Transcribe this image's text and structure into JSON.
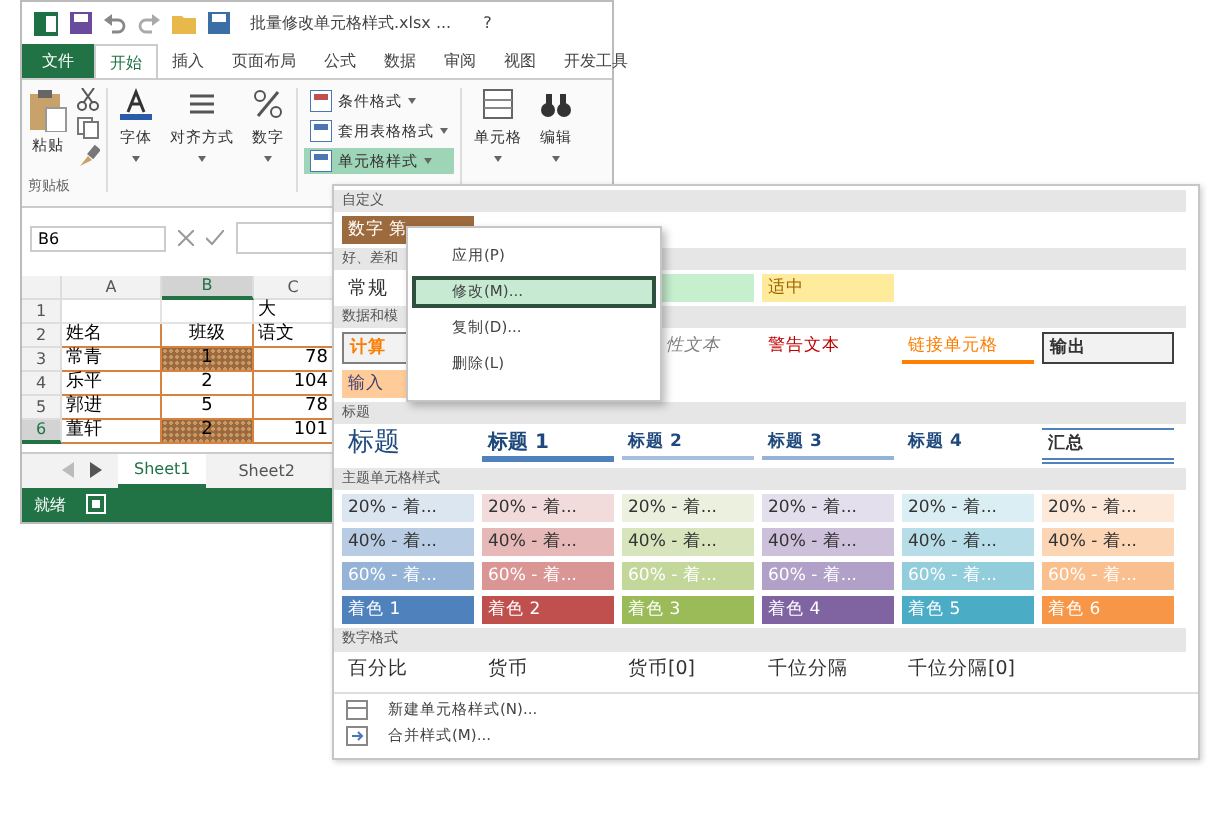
{
  "window": {
    "title": "批量修改单元格样式.xlsx ...",
    "help": "?"
  },
  "ribbon_tabs": [
    {
      "label": "文件",
      "kind": "file",
      "selected": false
    },
    {
      "label": "开始",
      "kind": "tab",
      "selected": true
    },
    {
      "label": "插入",
      "kind": "tab",
      "selected": false
    },
    {
      "label": "页面布局",
      "kind": "tab",
      "selected": false
    },
    {
      "label": "公式",
      "kind": "tab",
      "selected": false
    },
    {
      "label": "数据",
      "kind": "tab",
      "selected": false
    },
    {
      "label": "审阅",
      "kind": "tab",
      "selected": false
    },
    {
      "label": "视图",
      "kind": "tab",
      "selected": false
    },
    {
      "label": "开发工具",
      "kind": "tab",
      "selected": false
    }
  ],
  "ribbon": {
    "paste": "粘贴",
    "clipboard_group": "剪贴板",
    "buttons": [
      {
        "label": "字体",
        "kind": "font"
      },
      {
        "label": "对齐方式",
        "kind": "align"
      },
      {
        "label": "数字",
        "kind": "percent"
      }
    ],
    "style_commands": [
      {
        "label": "条件格式",
        "selected": false
      },
      {
        "label": "套用表格格式",
        "selected": false
      },
      {
        "label": "单元格样式",
        "selected": true
      }
    ],
    "right_buttons": [
      {
        "label": "单元格",
        "kind": "cells"
      },
      {
        "label": "编辑",
        "kind": "find"
      }
    ]
  },
  "name_box": "B6",
  "sheet": {
    "columns": [
      {
        "label": "A",
        "selected": false
      },
      {
        "label": "B",
        "selected": true
      },
      {
        "label": "C",
        "selected": false
      }
    ],
    "rows": [
      {
        "number": "1",
        "selected": false,
        "cells": [
          {
            "styled": false
          },
          {
            "styled": false
          },
          {
            "text": "大",
            "styled": false
          }
        ]
      },
      {
        "number": "2",
        "selected": false,
        "cells": [
          {
            "text": "姓名",
            "styled": false
          },
          {
            "text": "班级",
            "styled": false
          },
          {
            "text": "语文",
            "styled": false
          }
        ]
      },
      {
        "number": "3",
        "selected": false,
        "cells": [
          {
            "text": "常青",
            "styled": false
          },
          {
            "text": "1",
            "styled": true
          },
          {
            "text": "78",
            "styled": false
          }
        ]
      },
      {
        "number": "4",
        "selected": false,
        "cells": [
          {
            "text": "乐平",
            "styled": false
          },
          {
            "text": "2",
            "styled": false
          },
          {
            "text": "104",
            "styled": false
          }
        ]
      },
      {
        "number": "5",
        "selected": false,
        "cells": [
          {
            "text": "郭进",
            "styled": false
          },
          {
            "text": "5",
            "styled": false
          },
          {
            "text": "78",
            "styled": false
          }
        ]
      },
      {
        "number": "6",
        "selected": true,
        "cells": [
          {
            "text": "董轩",
            "styled": false
          },
          {
            "text": "2",
            "styled": true
          },
          {
            "text": "101",
            "styled": false
          }
        ]
      }
    ],
    "tabs": [
      {
        "label": "Sheet1",
        "selected": true
      },
      {
        "label": "Sheet2",
        "selected": false
      }
    ]
  },
  "status_bar": {
    "text": "就绪"
  },
  "gallery": {
    "sections": [
      {
        "title": "自定义",
        "items": [
          {
            "label": "数字 第",
            "kind": "custom"
          }
        ]
      },
      {
        "title": "好、差和",
        "items": [
          {
            "label": "常规",
            "kind": "normal"
          },
          {
            "kind": "good"
          },
          {
            "label": "适中",
            "kind": "neutral"
          }
        ]
      },
      {
        "title": "数据和模",
        "items": [
          {
            "label": "计算",
            "kind": "calc"
          },
          {
            "label": "性文本",
            "kind": "explain"
          },
          {
            "label": "警告文本",
            "kind": "warning"
          },
          {
            "label": "链接单元格",
            "kind": "linked"
          },
          {
            "label": "输出",
            "kind": "output"
          },
          {
            "label": "输入",
            "kind": "input"
          }
        ]
      },
      {
        "title": "标题",
        "items": [
          {
            "label": "标题",
            "kind": "title"
          },
          {
            "label": "标题 1",
            "kind": "h1"
          },
          {
            "label": "标题 2",
            "kind": "h2"
          },
          {
            "label": "标题 3",
            "kind": "h3"
          },
          {
            "label": "标题 4",
            "kind": "h4"
          },
          {
            "label": "汇总",
            "kind": "total"
          }
        ]
      },
      {
        "title": "主题单元格样式",
        "items": [
          {
            "label": "20% - 着...",
            "kind": "theme",
            "color": "#dce6f1"
          },
          {
            "label": "20% - 着...",
            "kind": "theme",
            "color": "#f2dcdb"
          },
          {
            "label": "20% - 着...",
            "kind": "theme",
            "color": "#ebf1de"
          },
          {
            "label": "20% - 着...",
            "kind": "theme",
            "color": "#e4dfec"
          },
          {
            "label": "20% - 着...",
            "kind": "theme",
            "color": "#daeef3"
          },
          {
            "label": "20% - 着...",
            "kind": "theme",
            "color": "#fde9d9"
          },
          {
            "label": "40% - 着...",
            "kind": "theme",
            "color": "#b8cce4"
          },
          {
            "label": "40% - 着...",
            "kind": "theme",
            "color": "#e6b8b7"
          },
          {
            "label": "40% - 着...",
            "kind": "theme",
            "color": "#d8e4bc"
          },
          {
            "label": "40% - 着...",
            "kind": "theme",
            "color": "#ccc0da"
          },
          {
            "label": "40% - 着...",
            "kind": "theme",
            "color": "#b7dee8"
          },
          {
            "label": "40% - 着...",
            "kind": "theme",
            "color": "#fcd5b4"
          },
          {
            "label": "60% - 着...",
            "kind": "accent",
            "color": "#95b3d7"
          },
          {
            "label": "60% - 着...",
            "kind": "accent",
            "color": "#da9694"
          },
          {
            "label": "60% - 着...",
            "kind": "accent",
            "color": "#c4d79b"
          },
          {
            "label": "60% - 着...",
            "kind": "accent",
            "color": "#b1a0c7"
          },
          {
            "label": "60% - 着...",
            "kind": "accent",
            "color": "#92cddc"
          },
          {
            "label": "60% - 着...",
            "kind": "accent",
            "color": "#fabf8f"
          },
          {
            "label": "着色 1",
            "kind": "accent",
            "color": "#4f81bd"
          },
          {
            "label": "着色 2",
            "kind": "accent",
            "color": "#c0504d"
          },
          {
            "label": "着色 3",
            "kind": "accent",
            "color": "#9bbb59"
          },
          {
            "label": "着色 4",
            "kind": "accent",
            "color": "#8064a2"
          },
          {
            "label": "着色 5",
            "kind": "accent",
            "color": "#4bacc6"
          },
          {
            "label": "着色 6",
            "kind": "accent",
            "color": "#f79646"
          }
        ]
      },
      {
        "title": "数字格式",
        "items": [
          {
            "label": "百分比",
            "kind": "normal"
          },
          {
            "label": "货币",
            "kind": "normal"
          },
          {
            "label": "货币[0]",
            "kind": "normal"
          },
          {
            "label": "千位分隔",
            "kind": "normal"
          },
          {
            "label": "千位分隔[0]",
            "kind": "normal"
          }
        ]
      }
    ],
    "commands": [
      {
        "label": "新建单元格样式(N)...",
        "kind": "new"
      },
      {
        "label": "合并样式(M)...",
        "kind": "merge"
      }
    ]
  },
  "context_menu": [
    {
      "label": "应用(P)",
      "selected": false
    },
    {
      "label": "修改(M)...",
      "selected": true
    },
    {
      "label": "复制(D)...",
      "selected": false
    },
    {
      "label": "删除(L)",
      "selected": false
    }
  ]
}
